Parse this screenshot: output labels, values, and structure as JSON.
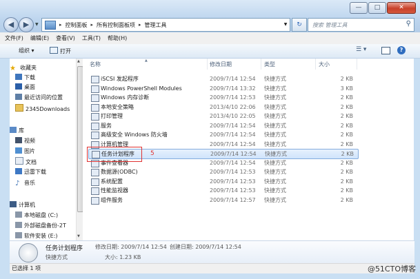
{
  "window": {
    "caption": {
      "minimize": "—",
      "maximize": "□",
      "close": "✕"
    }
  },
  "address": {
    "crumbs": [
      "控制面板",
      "所有控制面板项",
      "管理工具"
    ],
    "search_placeholder": "搜索 管理工具"
  },
  "menu": [
    "文件(F)",
    "编辑(E)",
    "查看(V)",
    "工具(T)",
    "帮助(H)"
  ],
  "toolbar": {
    "organize": "组织 ▾",
    "open": "打开",
    "view": "☰ ▾",
    "help": "?"
  },
  "nav": {
    "favorites": {
      "label": "收藏夹",
      "items": [
        "下载",
        "桌面",
        "最近访问的位置",
        "2345Downloads"
      ]
    },
    "libraries": {
      "label": "库",
      "items": [
        "视频",
        "图片",
        "文档",
        "迅雷下载",
        "音乐"
      ]
    },
    "computer": {
      "label": "计算机",
      "items": [
        "本地磁盘 (C:)",
        "外部磁盘备份-2T",
        "软件安装 (E:)"
      ]
    }
  },
  "columns": {
    "name": "名称",
    "date": "修改日期",
    "type": "类型",
    "size": "大小"
  },
  "files": [
    {
      "name": "iSCSI 发起程序",
      "date": "2009/7/14 12:54",
      "type": "快捷方式",
      "size": "2 KB"
    },
    {
      "name": "Windows PowerShell Modules",
      "date": "2009/7/14 13:32",
      "type": "快捷方式",
      "size": "3 KB"
    },
    {
      "name": "Windows 内存诊断",
      "date": "2009/7/14 12:53",
      "type": "快捷方式",
      "size": "2 KB"
    },
    {
      "name": "本地安全策略",
      "date": "2013/4/10 22:06",
      "type": "快捷方式",
      "size": "2 KB"
    },
    {
      "name": "打印管理",
      "date": "2013/4/10 22:05",
      "type": "快捷方式",
      "size": "2 KB"
    },
    {
      "name": "服务",
      "date": "2009/7/14 12:54",
      "type": "快捷方式",
      "size": "2 KB"
    },
    {
      "name": "高级安全 Windows 防火墙",
      "date": "2009/7/14 12:54",
      "type": "快捷方式",
      "size": "2 KB"
    },
    {
      "name": "计算机管理",
      "date": "2009/7/14 12:54",
      "type": "快捷方式",
      "size": "2 KB"
    },
    {
      "name": "任务计划程序",
      "date": "2009/7/14 12:54",
      "type": "快捷方式",
      "size": "2 KB"
    },
    {
      "name": "事件查看器",
      "date": "2009/7/14 12:54",
      "type": "快捷方式",
      "size": "2 KB"
    },
    {
      "name": "数据源(ODBC)",
      "date": "2009/7/14 12:53",
      "type": "快捷方式",
      "size": "2 KB"
    },
    {
      "name": "系统配置",
      "date": "2009/7/14 12:53",
      "type": "快捷方式",
      "size": "2 KB"
    },
    {
      "name": "性能监视器",
      "date": "2009/7/14 12:53",
      "type": "快捷方式",
      "size": "2 KB"
    },
    {
      "name": "组件服务",
      "date": "2009/7/14 12:57",
      "type": "快捷方式",
      "size": "2 KB"
    }
  ],
  "selected_index": 8,
  "annotation": "5",
  "details": {
    "name": "任务计划程序",
    "type": "快捷方式",
    "modified_label": "修改日期: 2009/7/14 12:54",
    "created_label": "创建日期: 2009/7/14 12:54",
    "size_label": "大小: 1.23 KB"
  },
  "status": "已选择 1 项",
  "watermark": "@51CTO博客"
}
